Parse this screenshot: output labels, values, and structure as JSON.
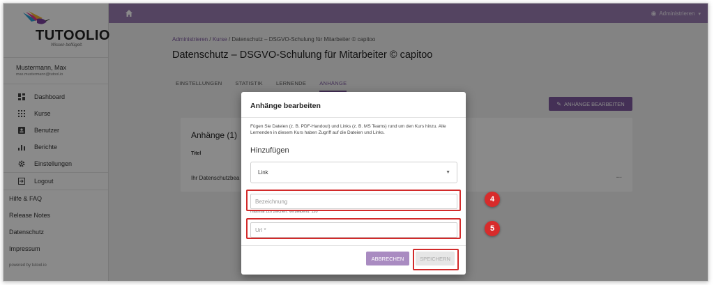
{
  "brand": {
    "name": "TUTOOLIO",
    "tagline": "Wissen beflügelt."
  },
  "user": {
    "name": "Mustermann, Max",
    "email": "max.mustermann@tutool.io"
  },
  "sidebar": {
    "nav": [
      {
        "label": "Dashboard",
        "icon": "dashboard-icon"
      },
      {
        "label": "Kurse",
        "icon": "courses-grid-icon"
      },
      {
        "label": "Benutzer",
        "icon": "user-card-icon"
      },
      {
        "label": "Berichte",
        "icon": "bar-chart-icon"
      },
      {
        "label": "Einstellungen",
        "icon": "gear-icon"
      }
    ],
    "logout": "Logout",
    "links": [
      "Hilfe & FAQ",
      "Release Notes",
      "Datenschutz",
      "Impressum"
    ],
    "powered": "powered by tutool.io"
  },
  "topbar": {
    "account_label": "Administrieren"
  },
  "breadcrumb": {
    "part1": "Administrieren",
    "sep1": " / ",
    "part2": "Kurse",
    "sep2": " / ",
    "part3": "Datenschutz – DSGVO-Schulung für Mitarbeiter © capitoo"
  },
  "page": {
    "title": "Datenschutz – DSGVO-Schulung für Mitarbeiter © capitoo"
  },
  "tabs": [
    "EINSTELLUNGEN",
    "STATISTIK",
    "LERNENDE",
    "ANHÄNGE"
  ],
  "edit_button": "ANHÄNGE BEARBEITEN",
  "card": {
    "title": "Anhänge (1)",
    "column": "Titel",
    "row": "Ihr Datenschutzbea",
    "more": "..."
  },
  "dialog": {
    "title": "Anhänge bearbeiten",
    "description": "Fügen Sie Dateien (z. B. PDF-Handout) und Links (z. B. MS Teams) rund um den Kurs hinzu. Alle Lernenden in diesem Kurs haben Zugriff auf die Dateien und Links.",
    "subtitle": "Hinzufügen",
    "type_value": "Link",
    "name_placeholder": "Bezeichnung",
    "hint": "maximal 120 Zeichen. Verbleibend: 120",
    "url_placeholder": "Url *",
    "cancel": "ABBRECHEN",
    "save": "SPEICHERN"
  },
  "callouts": [
    "4",
    "5"
  ],
  "colors": {
    "accent": "#7e5aa0",
    "topbar": "#9b7fb4",
    "callout": "#d82b2b"
  }
}
